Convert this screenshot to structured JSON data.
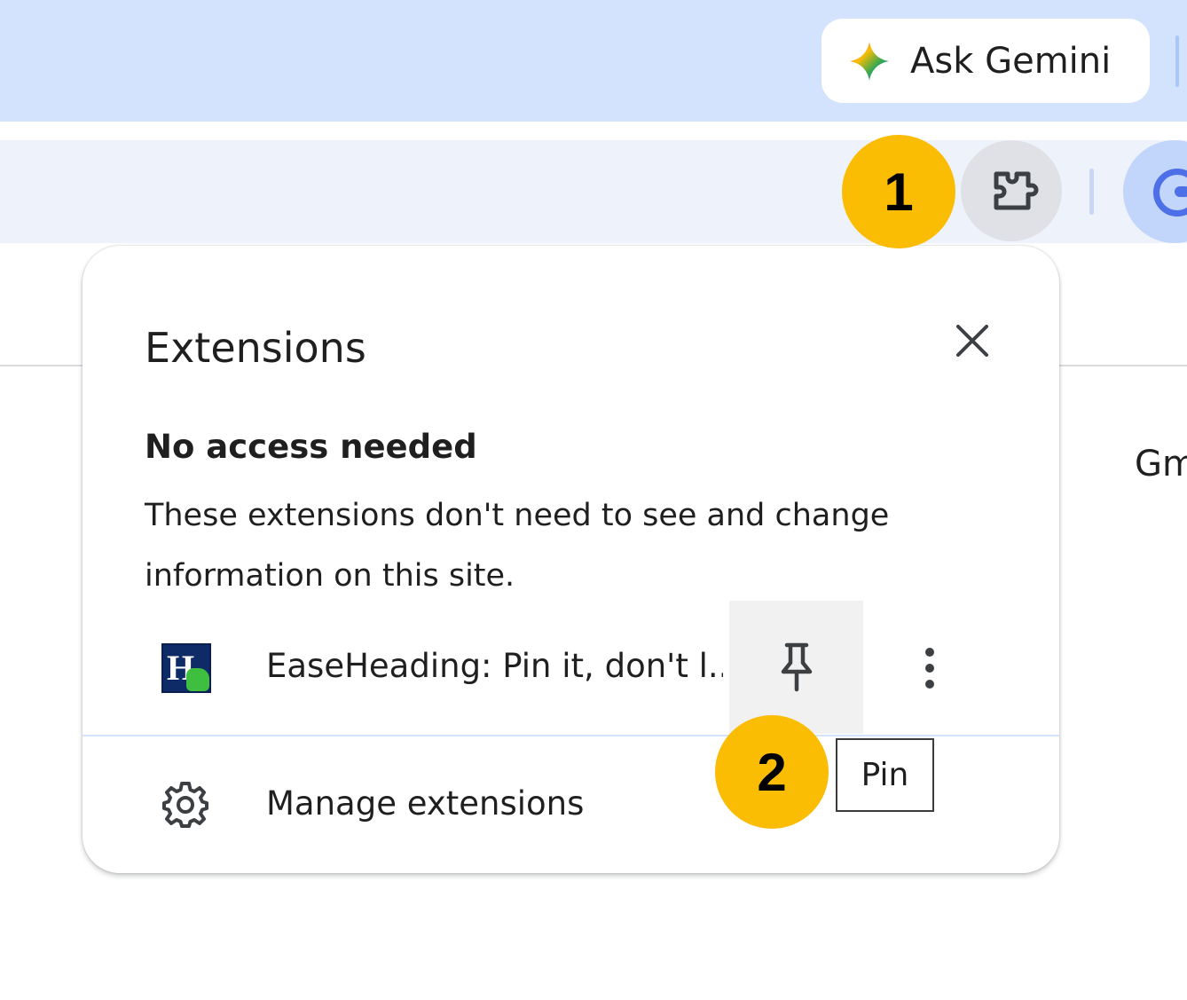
{
  "tabstrip": {
    "gemini_label": "Ask Gemini"
  },
  "page": {
    "partial_text": "Gm"
  },
  "badges": {
    "first": "1",
    "second": "2"
  },
  "popup": {
    "title": "Extensions",
    "section_heading": "No access needed",
    "section_desc": "These extensions don't need to see and change information on this site.",
    "extensions": [
      {
        "name": "EaseHeading: Pin it, don't l..."
      }
    ],
    "manage_label": "Manage extensions"
  },
  "tooltip": {
    "text": "Pin"
  },
  "colors": {
    "tabstrip_bg": "#d3e3fd",
    "toolbar_bg": "#eef2fa",
    "badge": "#fbbc04",
    "extension_button_bg": "#dfe1e6"
  },
  "icons": {
    "gemini": "gemini-sparkle-icon",
    "extensions": "puzzle-piece-icon",
    "close": "close-icon",
    "pin": "pin-icon",
    "more": "more-vertical-icon",
    "manage": "gear-icon"
  }
}
